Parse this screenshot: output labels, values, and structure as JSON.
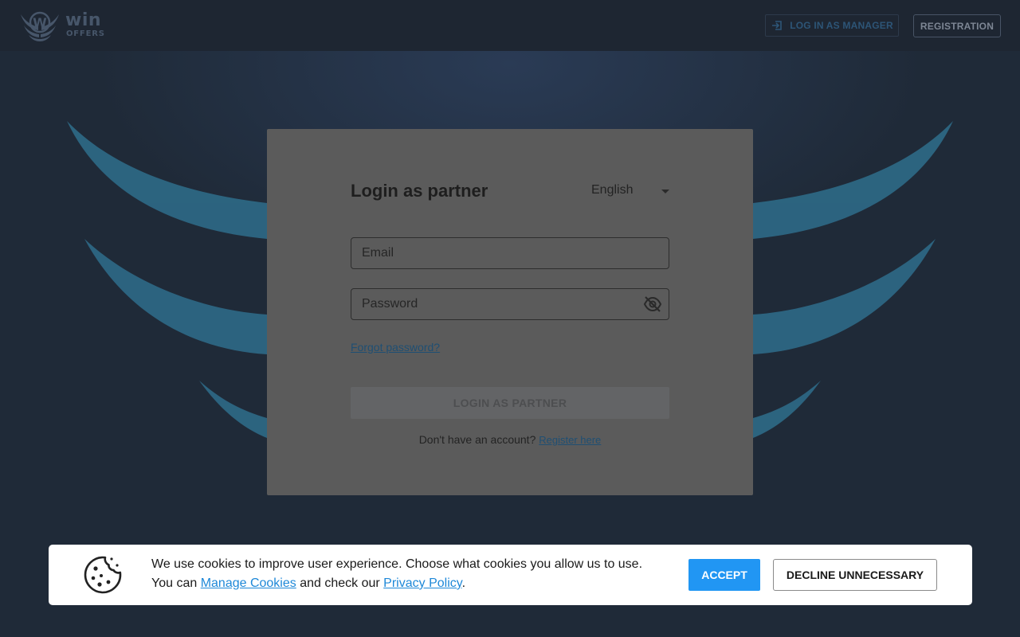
{
  "header": {
    "logo": {
      "main": "win",
      "sub": "OFFERS"
    },
    "manager_label": "LOG IN AS MANAGER",
    "manager_icon": "login-icon",
    "registration_label": "REGISTRATION"
  },
  "login": {
    "title": "Login as partner",
    "language": "English",
    "email_placeholder": "Email",
    "password_placeholder": "Password",
    "password_toggle_icon": "eye-off-icon",
    "forgot_label": "Forgot password?",
    "submit_label": "LOGIN AS PARTNER",
    "no_account_text": "Don't have an account?",
    "register_label": "Register here"
  },
  "cookie": {
    "icon": "cookie-icon",
    "line1": "We use cookies to improve user experience. Choose what cookies you allow us to use.",
    "you_can": "You can ",
    "manage_label": "Manage Cookies",
    "and_check": " and check our ",
    "privacy_label": "Privacy Policy",
    "period": ".",
    "accept_label": "ACCEPT",
    "decline_label": "DECLINE UNNECESSARY"
  },
  "colors": {
    "background": "#1f2a38",
    "wing": "#2e6a87",
    "accent": "#2196f3",
    "link": "#1e88d8"
  }
}
